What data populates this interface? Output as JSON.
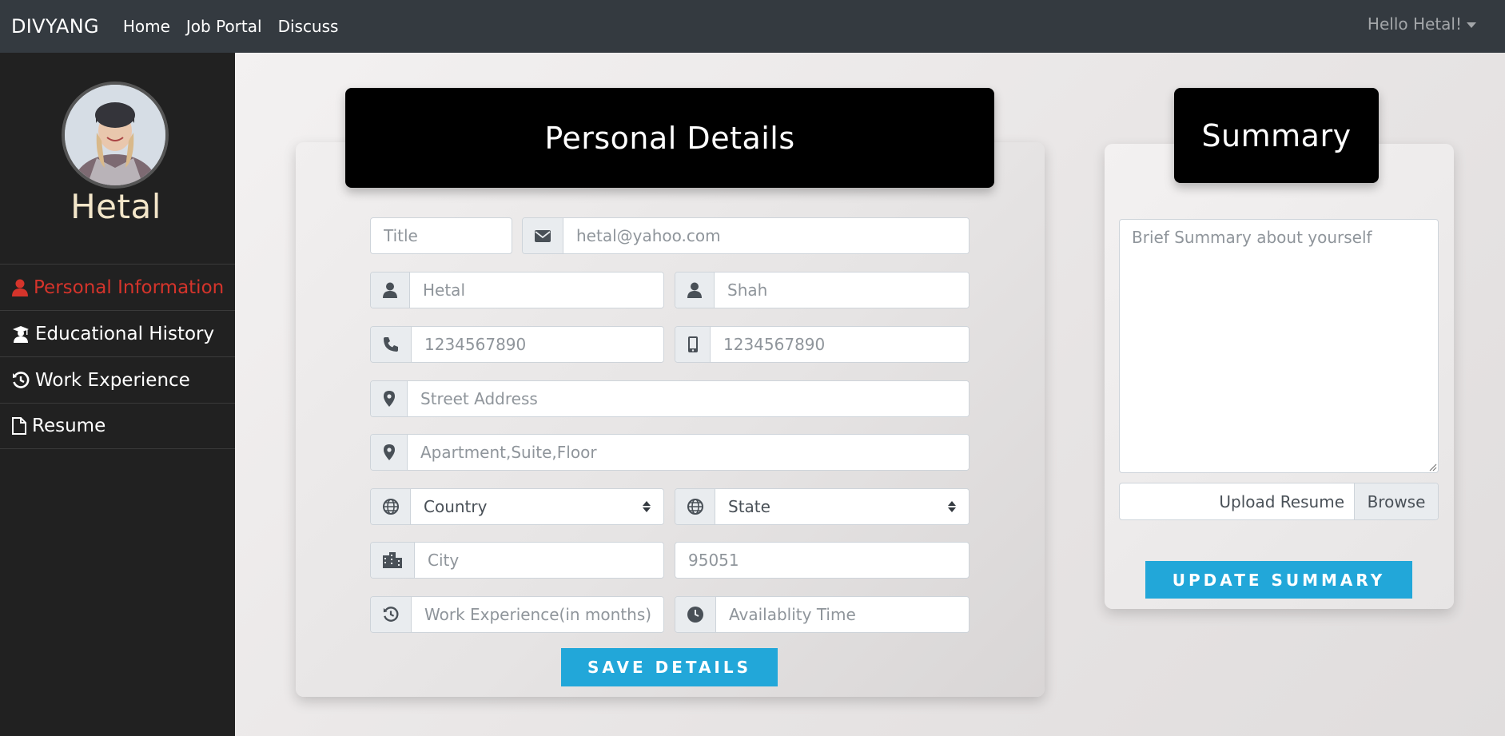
{
  "navbar": {
    "brand": "DIVYANG",
    "links": [
      "Home",
      "Job Portal",
      "Discuss"
    ],
    "user_menu": "Hello Hetal!"
  },
  "sidebar": {
    "user_name": "Hetal",
    "items": [
      {
        "label": "Personal Information",
        "icon": "user-icon",
        "active": true
      },
      {
        "label": "Educational History",
        "icon": "graduate-icon",
        "active": false
      },
      {
        "label": "Work Experience",
        "icon": "history-icon",
        "active": false
      },
      {
        "label": "Resume",
        "icon": "file-icon",
        "active": false
      }
    ]
  },
  "personal_details": {
    "title": "Personal Details",
    "fields": {
      "title": {
        "value": "",
        "placeholder": "Title"
      },
      "email": {
        "value": "",
        "placeholder": "hetal@yahoo.com"
      },
      "first_name": {
        "value": "",
        "placeholder": "Hetal"
      },
      "last_name": {
        "value": "",
        "placeholder": "Shah"
      },
      "phone": {
        "value": "",
        "placeholder": "1234567890"
      },
      "mobile": {
        "value": "",
        "placeholder": "1234567890"
      },
      "street": {
        "value": "",
        "placeholder": "Street Address"
      },
      "apartment": {
        "value": "",
        "placeholder": "Apartment,Suite,Floor"
      },
      "country": {
        "selected": "Country"
      },
      "state": {
        "selected": "State"
      },
      "city": {
        "value": "",
        "placeholder": "City"
      },
      "zip": {
        "value": "",
        "placeholder": "95051"
      },
      "work_experience": {
        "value": "",
        "placeholder": "Work Experience(in months)"
      },
      "availability": {
        "value": "",
        "placeholder": "Availablity Time"
      }
    },
    "save_button": "SAVE DETAILS"
  },
  "summary": {
    "title": "Summary",
    "textarea_placeholder": "Brief Summary about yourself",
    "upload_label": "Upload Resume",
    "browse_label": "Browse",
    "update_button": "UPDATE SUMMARY"
  },
  "colors": {
    "navbar": "#343a40",
    "sidebar": "#212121",
    "active_menu": "#d5342b",
    "accent_button": "#22a7d9",
    "sidebar_name": "#f3e6c9"
  }
}
